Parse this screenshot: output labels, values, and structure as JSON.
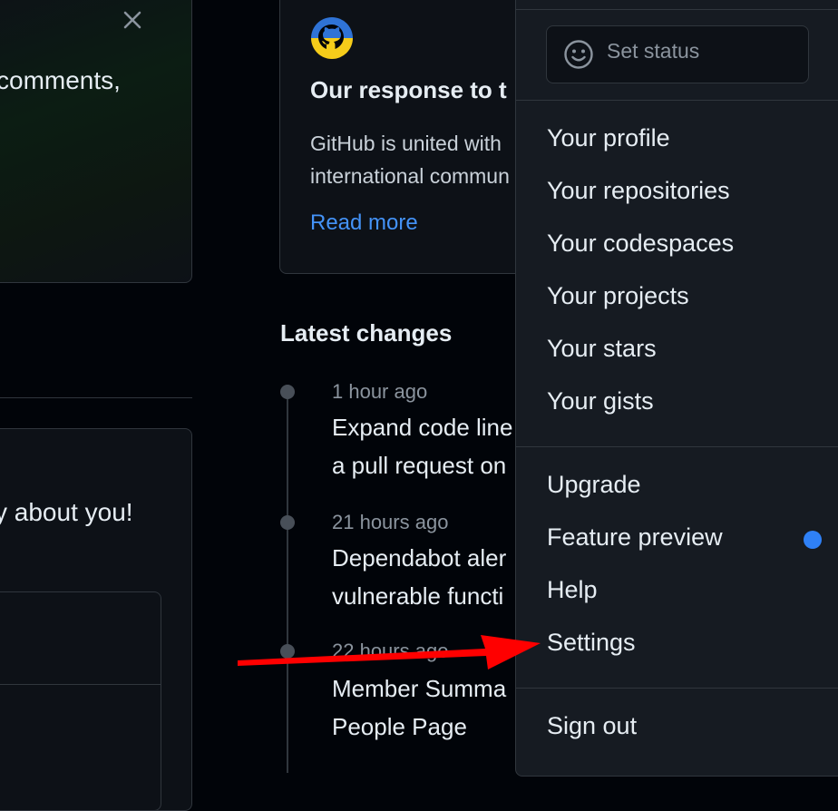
{
  "left": {
    "text1": "comments,",
    "text2": "y about you!"
  },
  "announcement": {
    "title": "Our response to t",
    "body_line1": "GitHub is united with",
    "body_line2": "international commun",
    "link": "Read more"
  },
  "latest_changes": {
    "heading": "Latest changes",
    "items": [
      {
        "time": "1 hour ago",
        "line1": "Expand code line",
        "line2": "a pull request on"
      },
      {
        "time": "21 hours ago",
        "line1": "Dependabot aler",
        "line2": "vulnerable functi"
      },
      {
        "time": "22 hours ago",
        "line1": "Member Summa",
        "line2": "People Page"
      }
    ]
  },
  "menu": {
    "set_status": "Set status",
    "items": [
      "Your profile",
      "Your repositories",
      "Your codespaces",
      "Your projects",
      "Your stars",
      "Your gists",
      "Upgrade",
      "Feature preview",
      "Help",
      "Settings",
      "Sign out"
    ]
  },
  "colors": {
    "background": "#010409",
    "menu_bg": "#161b22",
    "link": "#4493f8",
    "arrow": "#ff0000",
    "feature_dot": "#2f81f7"
  },
  "icons": [
    "close-icon",
    "octocat-icon",
    "smiley-icon"
  ]
}
